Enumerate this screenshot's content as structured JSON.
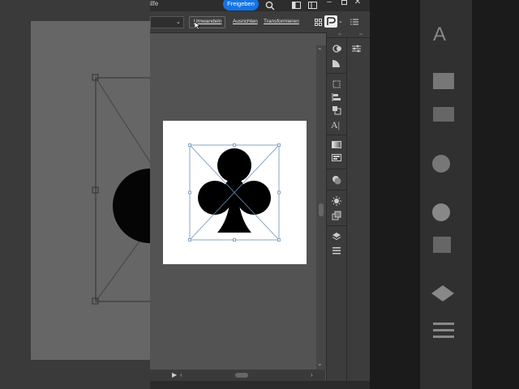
{
  "titlebar": {
    "menu_fragment": "ilfe",
    "share_label": "Freigeben",
    "search_icon": "search-icon",
    "window_buttons": [
      "minimize",
      "maximize",
      "close"
    ]
  },
  "control_bar": {
    "buttons": [
      "Umwandeln",
      "Ausrichten",
      "Transformieren"
    ]
  },
  "tools": {
    "icons": [
      "appearance-icon",
      "color-icon",
      "transform-icon",
      "align-icon",
      "pathfinder-icon",
      "character-icon",
      "gradient-icon",
      "image-icon",
      "transparency-icon",
      "brightness-icon",
      "export-icon",
      "layers-icon",
      "stack-icon"
    ]
  },
  "canvas": {
    "artwork": "club-icon",
    "artboard_color": "#ffffff"
  },
  "colors": {
    "accent": "#1473e6",
    "canvas": "#535353",
    "panel": "#3c3c3c",
    "selection": "#6b8fb8"
  }
}
